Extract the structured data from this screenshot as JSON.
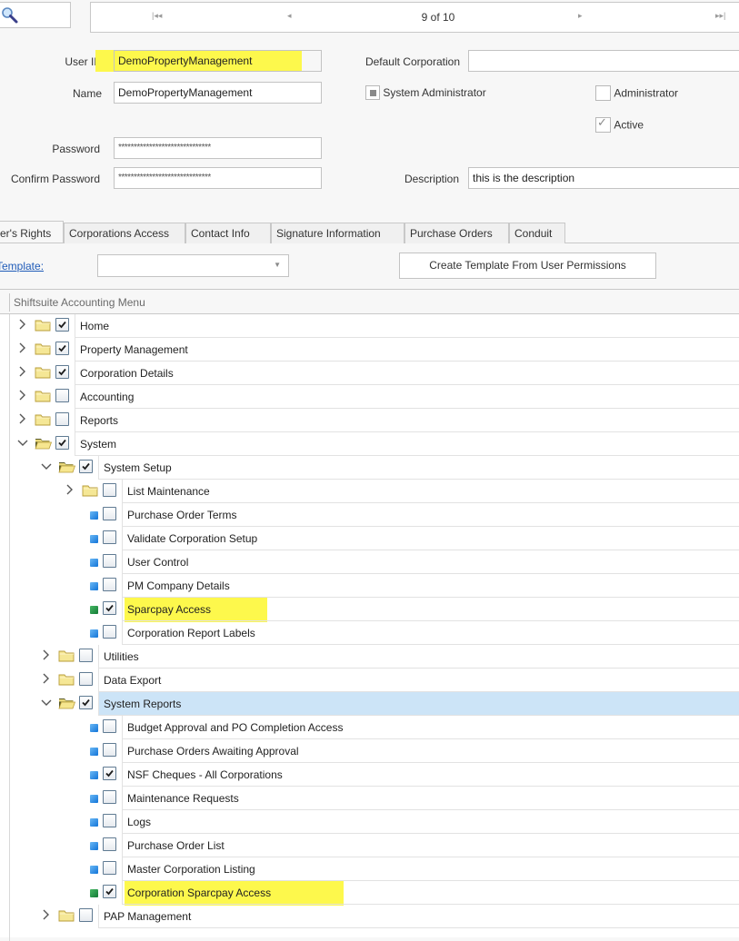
{
  "toolbar": {
    "search_icon": "magnifier-icon",
    "navigator": {
      "first_icon": "⏮",
      "prev_icon": "◂",
      "position_text": "9 of 10",
      "next_icon": "▸",
      "last_icon": "⏭"
    }
  },
  "form": {
    "user_id_label": "User ID",
    "user_id_value": "DemoPropertyManagement",
    "name_label": "Name",
    "name_value": "DemoPropertyManagement",
    "password_label": "Password",
    "password_value": "******************************",
    "confirm_password_label": "Confirm Password",
    "confirm_password_value": "******************************",
    "default_corporation_label": "Default Corporation",
    "default_corporation_value": "",
    "system_admin_label": "System Administrator",
    "system_admin_state": "indeterminate",
    "administrator_label": "Administrator",
    "administrator_checked": false,
    "active_label": "Active",
    "active_checked": true,
    "description_label": "Description",
    "description_value": "this is the description"
  },
  "tabs": [
    {
      "label": "er's Rights",
      "active": true
    },
    {
      "label": "Corporations Access",
      "active": false
    },
    {
      "label": "Contact Info",
      "active": false
    },
    {
      "label": "Signature Information",
      "active": false
    },
    {
      "label": "Purchase Orders",
      "active": false
    },
    {
      "label": "Conduit",
      "active": false
    }
  ],
  "template": {
    "link_label": "Template:",
    "combo_value": "",
    "create_button_label": "Create Template From User Permissions"
  },
  "tree": {
    "header": "Shiftsuite Accounting Menu",
    "rows": [
      {
        "label": "Home",
        "level": 0,
        "type": "folder",
        "expanded": false,
        "checked": true
      },
      {
        "label": "Property Management",
        "level": 0,
        "type": "folder",
        "expanded": false,
        "checked": true
      },
      {
        "label": "Corporation Details",
        "level": 0,
        "type": "folder",
        "expanded": false,
        "checked": true
      },
      {
        "label": "Accounting",
        "level": 0,
        "type": "folder",
        "expanded": false,
        "checked": false
      },
      {
        "label": "Reports",
        "level": 0,
        "type": "folder",
        "expanded": false,
        "checked": false
      },
      {
        "label": "System",
        "level": 0,
        "type": "folder",
        "expanded": true,
        "checked": true
      },
      {
        "label": "System Setup",
        "level": 1,
        "type": "folder",
        "expanded": true,
        "checked": true
      },
      {
        "label": "List Maintenance",
        "level": 2,
        "type": "folder",
        "expanded": false,
        "checked": false
      },
      {
        "label": "Purchase Order Terms",
        "level": 2,
        "type": "leaf",
        "node_color": "blue",
        "checked": false
      },
      {
        "label": "Validate Corporation Setup",
        "level": 2,
        "type": "leaf",
        "node_color": "blue",
        "checked": false
      },
      {
        "label": "User Control",
        "level": 2,
        "type": "leaf",
        "node_color": "blue",
        "checked": false
      },
      {
        "label": "PM Company Details",
        "level": 2,
        "type": "leaf",
        "node_color": "blue",
        "checked": false
      },
      {
        "label": "Sparcpay Access",
        "level": 2,
        "type": "leaf",
        "node_color": "green",
        "checked": true,
        "highlighted": true
      },
      {
        "label": "Corporation Report Labels",
        "level": 2,
        "type": "leaf",
        "node_color": "blue",
        "checked": false
      },
      {
        "label": "Utilities",
        "level": 1,
        "type": "folder",
        "expanded": false,
        "checked": false
      },
      {
        "label": "Data Export",
        "level": 1,
        "type": "folder",
        "expanded": false,
        "checked": false
      },
      {
        "label": "System Reports",
        "level": 1,
        "type": "folder",
        "expanded": true,
        "checked": true,
        "selected": true
      },
      {
        "label": "Budget Approval and PO Completion Access",
        "level": 2,
        "type": "leaf",
        "node_color": "blue",
        "checked": false
      },
      {
        "label": "Purchase Orders Awaiting Approval",
        "level": 2,
        "type": "leaf",
        "node_color": "blue",
        "checked": false
      },
      {
        "label": "NSF Cheques - All Corporations",
        "level": 2,
        "type": "leaf",
        "node_color": "blue",
        "checked": true
      },
      {
        "label": "Maintenance Requests",
        "level": 2,
        "type": "leaf",
        "node_color": "blue",
        "checked": false
      },
      {
        "label": "Logs",
        "level": 2,
        "type": "leaf",
        "node_color": "blue",
        "checked": false
      },
      {
        "label": "Purchase Order List",
        "level": 2,
        "type": "leaf",
        "node_color": "blue",
        "checked": false
      },
      {
        "label": "Master Corporation Listing",
        "level": 2,
        "type": "leaf",
        "node_color": "blue",
        "checked": false
      },
      {
        "label": "Corporation Sparcpay Access",
        "level": 2,
        "type": "leaf",
        "node_color": "green",
        "checked": true,
        "highlighted": true
      },
      {
        "label": "PAP Management",
        "level": 1,
        "type": "folder",
        "expanded": false,
        "checked": false
      }
    ]
  },
  "colors": {
    "highlight": "#fdf84c",
    "selected_row": "#cce4f7",
    "link": "#1f5bb8",
    "node_blue": "#1174d8",
    "node_green": "#137a36"
  }
}
